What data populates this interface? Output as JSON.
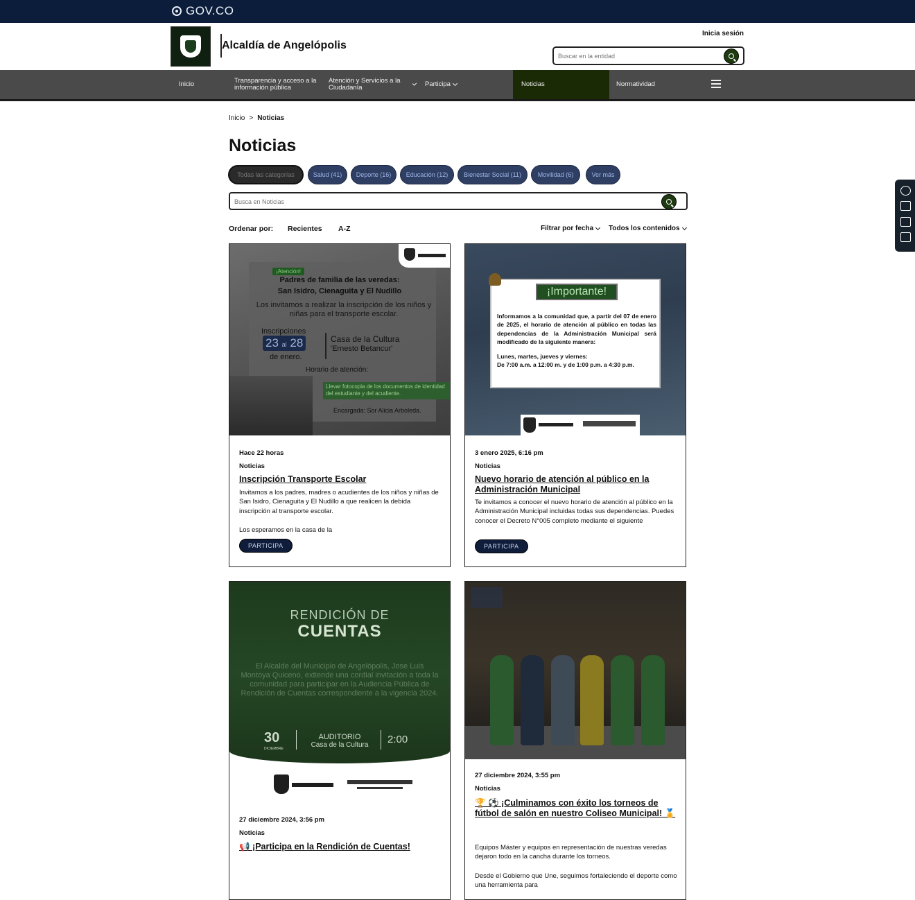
{
  "govbar": {
    "brand": "GOV.CO"
  },
  "header": {
    "site_title": "Alcaldía de Angelópolis",
    "login": "Inicia sesión",
    "search_placeholder": "Buscar en la entidad"
  },
  "nav": {
    "items": [
      {
        "label": "Inicio"
      },
      {
        "label": "Transparencia y acceso a la información pública"
      },
      {
        "label": "Atención y Servicios a la Ciudadanía"
      },
      {
        "label": "Participa"
      },
      {
        "label": "Noticias"
      },
      {
        "label": "Normatividad"
      }
    ]
  },
  "main": {
    "breadcrumb": {
      "home": "Inicio",
      "separator": ">",
      "current": "Noticias"
    },
    "title": "Noticias",
    "chips": [
      "Todas las categorías",
      "Salud (41)",
      "Deporte (16)",
      "Educación (12)",
      "Bienestar Social (11)",
      "Movilidad (6)",
      "Ver más"
    ],
    "search_placeholder": "Busca en Noticias",
    "sort": {
      "label": "Ordenar por:",
      "options": [
        "Recientes",
        "A-Z"
      ],
      "date_filter": "Filtrar por fecha",
      "content_filter": "Todos los contenidos"
    }
  },
  "cards": [
    {
      "date": "Hace 22 horas",
      "category": "Noticias",
      "title": "Inscripción Transporte Escolar",
      "desc": "Invitamos a los padres, madres o acudientes de los niños y niñas de San Isidro, Cienaguita y El Nudillo a que realicen la debida inscripción al transporte escolar.",
      "desc2": "Los esperamos en la casa de la",
      "button": "PARTICIPA",
      "image": {
        "tag": "¡Atención!",
        "line1": "Padres de familia de las veredas:",
        "line2": "San Isidro, Cienaguita y El Nudillo",
        "line3": "Los invitamos a realizar la inscripción de los niños y niñas para el transporte escolar.",
        "inscripciones": "Inscripciones",
        "date_from": "23",
        "date_al": "al",
        "date_to": "28",
        "month": "de enero.",
        "place1": "Casa de la Cultura",
        "place2": "'Ernesto Betancur'",
        "horario": "Horario de atención:",
        "band": "Llevar fotocopia de los documentos de identidad del estudiante y del acudiente.",
        "encargada": "Encargada: Sor Alicia Arboleda."
      }
    },
    {
      "date": "3 enero 2025, 6:16 pm",
      "category": "Noticias",
      "title": "Nuevo horario de atención al público en la Administración Municipal",
      "desc": "Te invitamos a conocer el nuevo horario de atención al público en la Administración Municipal incluidas todas sus dependencias. Puedes conocer el Decreto N°005 completo mediante el siguiente",
      "button": "PARTICIPA",
      "image": {
        "heading": "¡Importante!",
        "para": "Informamos a la comunidad que, a partir del 07 de enero de 2025, el horario de atención al público en todas las dependencias de la Administración Municipal será modificado de la siguiente manera:",
        "days": "Lunes, martes, jueves y viernes:",
        "hours": "De 7:00 a.m. a 12:00 m. y de 1:00 p.m. a 4:30 p.m."
      }
    },
    {
      "date": "27 diciembre 2024, 3:56 pm",
      "category": "Noticias",
      "title": "📢 ¡Participa en la Rendición de Cuentas!",
      "image": {
        "r1": "RENDICIÓN DE",
        "r2": "CUENTAS",
        "body": "El Alcalde del Municipio de Angelópolis, Jose Luis Montoya Quiceno, extiende una cordial invitación a toda la comunidad para participar en la Audiencia Pública de Rendición de Cuentas correspondiente a la vigencia 2024.",
        "day": "30",
        "month": "DICIEMBRE",
        "auditorio": "AUDITORIO",
        "lugar": "Casa de la Cultura",
        "time": "2:00"
      }
    },
    {
      "date": "27 diciembre 2024, 3:55 pm",
      "category": "Noticias",
      "title": "🏆 ⚽ ¡Culminamos con éxito los torneos de fútbol de salón en nuestro Coliseo Municipal! 🏅",
      "desc": "Equipos Máster y equipos en representación de nuestras veredas dejaron todo en la cancha durante los torneos.",
      "desc2": "Desde el Gobierno que Une, seguimos fortaleciendo el deporte como una herramienta para"
    }
  ],
  "colors": {
    "govbar": "#0b1d3a",
    "nav": "#4a4a4a",
    "nav_active": "#1a2a05",
    "chip": "#2f3f63",
    "button": "#0f1c3a"
  }
}
